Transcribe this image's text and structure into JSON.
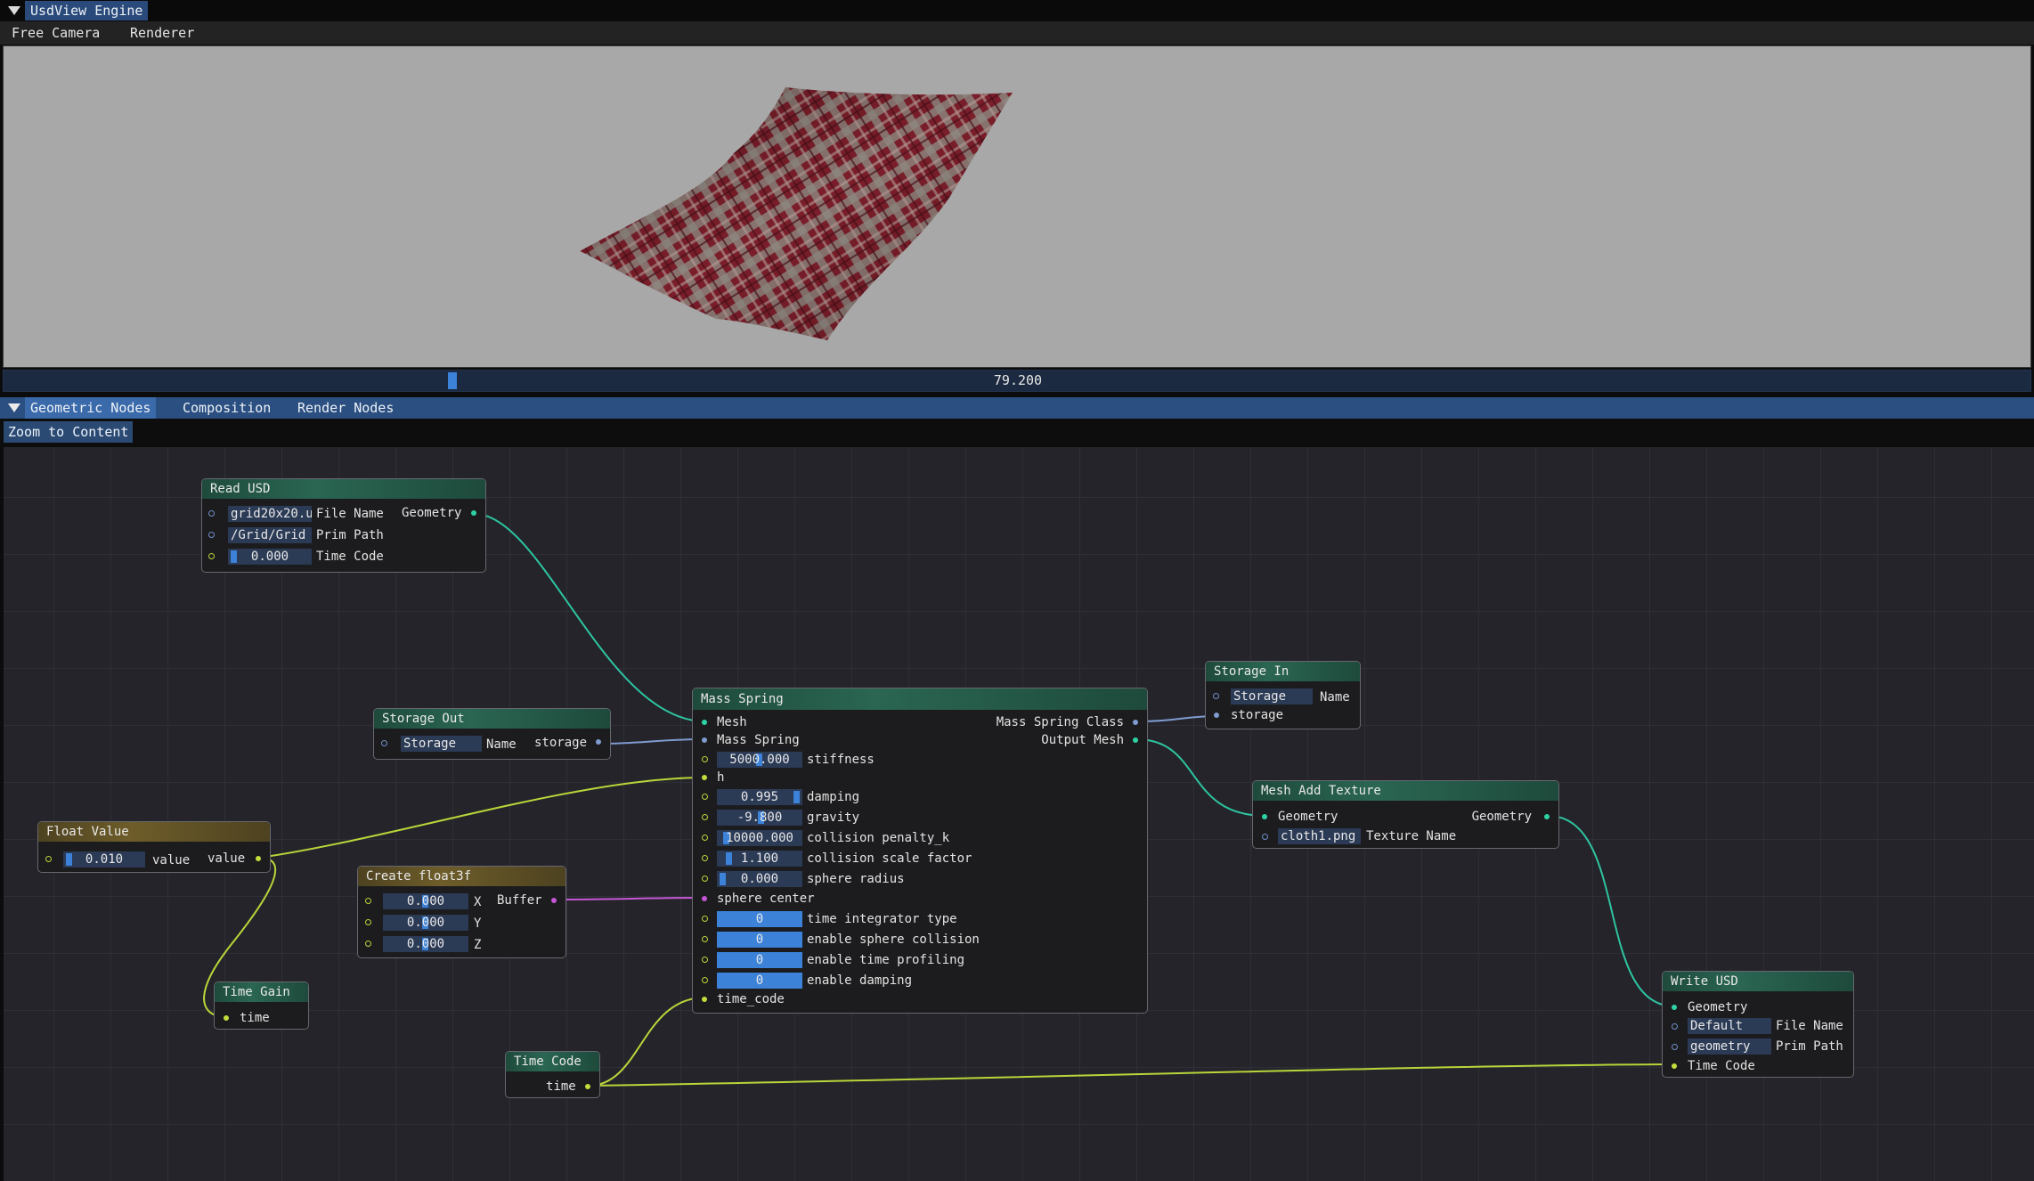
{
  "window": {
    "title": "UsdView Engine"
  },
  "menu": [
    "Free Camera",
    "Renderer"
  ],
  "timeline": {
    "value": "79.200",
    "fraction": 0.22
  },
  "node_editor": {
    "tabs": [
      "Geometric Nodes",
      "Composition",
      "Render Nodes"
    ],
    "active_tab": "Geometric Nodes",
    "zoom_label": "Zoom to Content"
  },
  "colors": {
    "wire_geometry": "#2ec4a0",
    "wire_value": "#b9d63a",
    "wire_storage": "#7f9bd0",
    "wire_buffer": "#c557d6"
  },
  "nodes": {
    "read_usd": {
      "title": "Read USD",
      "file_name_value": "grid20x20.u",
      "file_name_label": "File Name",
      "prim_path_value": "/Grid/Grid",
      "prim_path_label": "Prim Path",
      "time_code_value": "0.000",
      "time_code_label": "Time Code",
      "output": "Geometry"
    },
    "storage_out": {
      "title": "Storage Out",
      "name_value": "Storage",
      "name_label": "Name",
      "output": "storage"
    },
    "float_value": {
      "title": "Float Value",
      "value": "0.010",
      "value_label": "value",
      "output": "value"
    },
    "create_float3f": {
      "title": "Create float3f",
      "x": "0.000",
      "y": "0.000",
      "z": "0.000",
      "x_label": "X",
      "y_label": "Y",
      "z_label": "Z",
      "output": "Buffer"
    },
    "time_gain": {
      "title": "Time Gain",
      "input": "time"
    },
    "time_code": {
      "title": "Time Code",
      "output": "time"
    },
    "mass_spring": {
      "title": "Mass Spring",
      "in_mesh": "Mesh",
      "in_mass_spring": "Mass Spring",
      "out_class": "Mass Spring Class",
      "out_mesh": "Output Mesh",
      "stiffness": {
        "value": "5000.000",
        "label": "stiffness"
      },
      "h": "h",
      "damping": {
        "value": "0.995",
        "label": "damping"
      },
      "gravity": {
        "value": "-9.800",
        "label": "gravity"
      },
      "collision_penalty": {
        "value": "10000.000",
        "label": "collision penalty_k"
      },
      "collision_scale": {
        "value": "1.100",
        "label": "collision scale factor"
      },
      "sphere_radius": {
        "value": "0.000",
        "label": "sphere radius"
      },
      "sphere_center": "sphere center",
      "time_integrator": {
        "value": "0",
        "label": "time integrator type"
      },
      "sphere_collision": {
        "value": "0",
        "label": "enable sphere collision"
      },
      "time_profiling": {
        "value": "0",
        "label": "enable time profiling"
      },
      "enable_damping": {
        "value": "0",
        "label": "enable damping"
      },
      "time_code": "time_code"
    },
    "storage_in": {
      "title": "Storage In",
      "name_value": "Storage",
      "name_label": "Name",
      "output": "storage"
    },
    "mesh_add_texture": {
      "title": "Mesh Add Texture",
      "in_geometry": "Geometry",
      "out_geometry": "Geometry",
      "texture_value": "cloth1.png",
      "texture_label": "Texture Name"
    },
    "write_usd": {
      "title": "Write USD",
      "in_geometry": "Geometry",
      "file_name_value": "Default",
      "file_name_label": "File Name",
      "prim_path_value": "geometry",
      "prim_path_label": "Prim Path",
      "time_code": "Time Code"
    }
  }
}
